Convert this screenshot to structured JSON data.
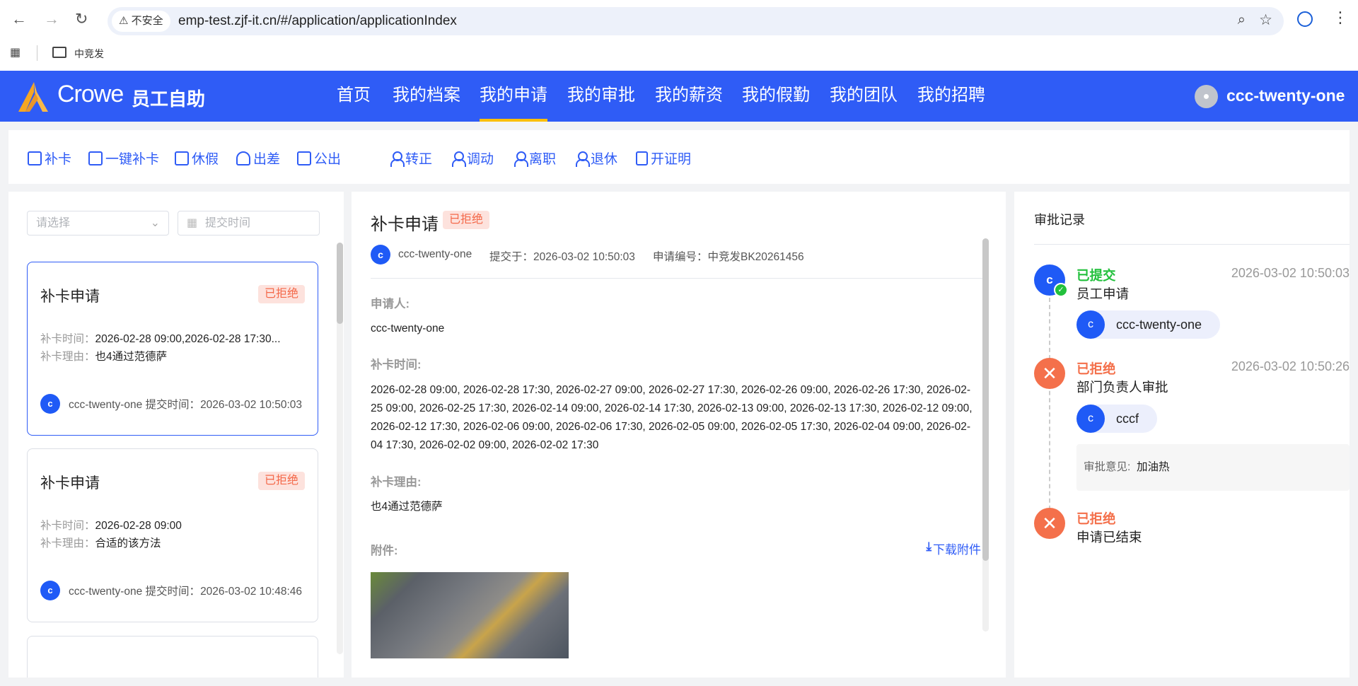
{
  "browser": {
    "security_label": "不安全",
    "url": "emp-test.zjf-it.cn/#/application/applicationIndex",
    "bookmark": "中竞发"
  },
  "header": {
    "brand": "Crowe",
    "app_name": "员工自助",
    "nav": [
      "首页",
      "我的档案",
      "我的申请",
      "我的审批",
      "我的薪资",
      "我的假勤",
      "我的团队",
      "我的招聘"
    ],
    "active_nav": "我的申请",
    "user": "ccc-twenty-one"
  },
  "toolbar": {
    "left": [
      "补卡",
      "一键补卡",
      "休假",
      "出差",
      "公出"
    ],
    "right": [
      "转正",
      "调动",
      "离职",
      "退休",
      "开证明"
    ]
  },
  "filters": {
    "status_placeholder": "请选择",
    "date_placeholder": "提交时间"
  },
  "list": [
    {
      "title": "补卡申请",
      "status": "已拒绝",
      "time_label": "补卡时间：",
      "time": "2026-02-28 09:00,2026-02-28 17:30...",
      "reason_label": "补卡理由：",
      "reason": "也4通过范德萨",
      "avatar": "c",
      "user": "ccc-twenty-one",
      "submit_label": "提交时间：",
      "submitted": "2026-03-02 10:50:03"
    },
    {
      "title": "补卡申请",
      "status": "已拒绝",
      "time_label": "补卡时间：",
      "time": "2026-02-28 09:00",
      "reason_label": "补卡理由：",
      "reason": "合适的该方法",
      "avatar": "c",
      "user": "ccc-twenty-one",
      "submit_label": "提交时间：",
      "submitted": "2026-03-02 10:48:46"
    }
  ],
  "detail": {
    "title": "补卡申请",
    "status": "已拒绝",
    "avatar": "c",
    "user": "ccc-twenty-one",
    "submitted": "提交于：2026-03-02 10:50:03",
    "number": "申请编号：中竞发BK20261456",
    "applicant_label": "申请人:",
    "applicant": "ccc-twenty-one",
    "times_label": "补卡时间:",
    "times": "2026-02-28 09:00, 2026-02-28 17:30, 2026-02-27 09:00, 2026-02-27 17:30, 2026-02-26 09:00, 2026-02-26 17:30, 2026-02-25 09:00, 2026-02-25 17:30, 2026-02-14 09:00, 2026-02-14 17:30, 2026-02-13 09:00, 2026-02-13 17:30, 2026-02-12 09:00, 2026-02-12 17:30, 2026-02-06 09:00, 2026-02-06 17:30, 2026-02-05 09:00, 2026-02-05 17:30, 2026-02-04 09:00, 2026-02-04 17:30, 2026-02-02 09:00, 2026-02-02 17:30",
    "reason_label": "补卡理由:",
    "reason": "也4通过范德萨",
    "attachment_label": "附件:",
    "download": "下载附件"
  },
  "approval": {
    "title": "审批记录",
    "steps": [
      {
        "status": "已提交",
        "color": "#22c03c",
        "name": "员工申请",
        "time": "2026-03-02 10:50:03",
        "avatar": "c",
        "person": "ccc-twenty-one"
      },
      {
        "status": "已拒绝",
        "color": "#f4704b",
        "name": "部门负责人审批",
        "time": "2026-03-02 10:50:26",
        "avatar": "c",
        "person": "cccf",
        "opinion_label": "审批意见:",
        "opinion": "加油热"
      },
      {
        "status": "已拒绝",
        "color": "#f4704b",
        "name": "申请已结束"
      }
    ]
  }
}
